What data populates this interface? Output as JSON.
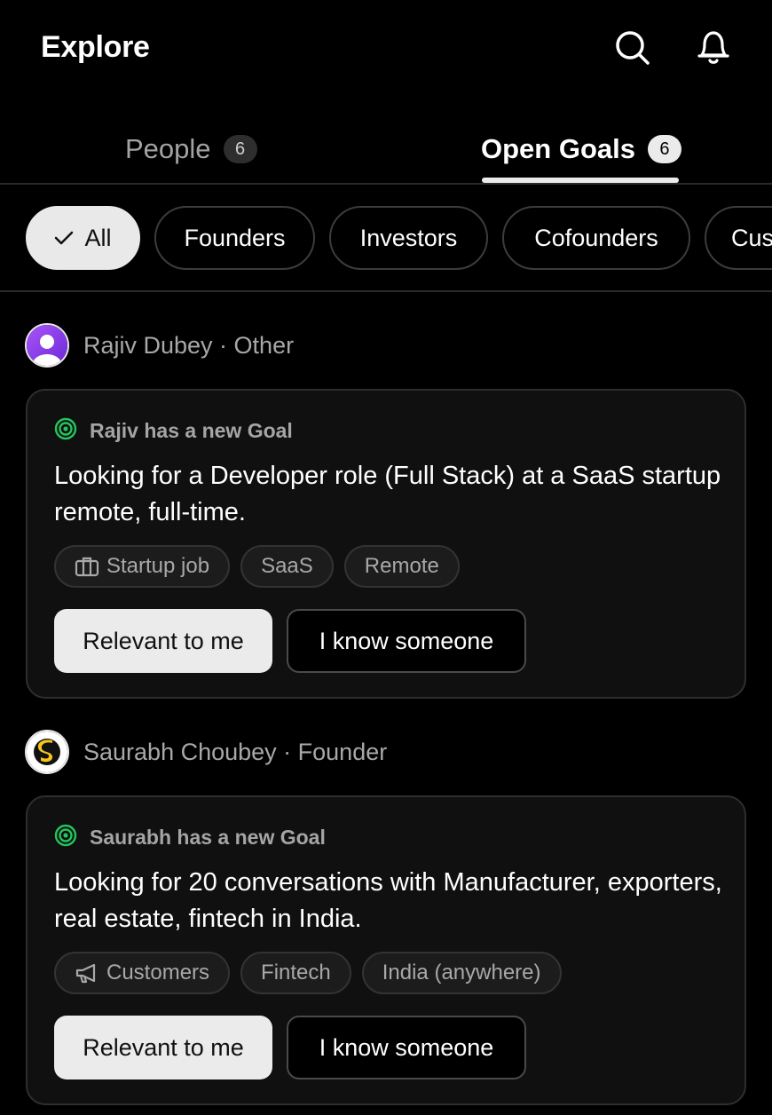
{
  "header": {
    "title": "Explore",
    "icons": [
      "search-icon",
      "bell-icon"
    ]
  },
  "tabs": [
    {
      "label": "People",
      "count": "6",
      "active": false
    },
    {
      "label": "Open Goals",
      "count": "6",
      "active": true
    }
  ],
  "filters": [
    {
      "label": "All",
      "active": true
    },
    {
      "label": "Founders",
      "active": false
    },
    {
      "label": "Investors",
      "active": false
    },
    {
      "label": "Cofounders",
      "active": false
    },
    {
      "label": "Cus",
      "active": false
    }
  ],
  "posts": [
    {
      "author": "Rajiv Dubey · Other",
      "goal_heading": "Rajiv has a new Goal",
      "goal_text": "Looking for a Developer role (Full Stack) at a SaaS startup remote, full-time.",
      "tags": [
        {
          "label": "Startup job",
          "icon": "briefcase-icon"
        },
        {
          "label": "SaaS"
        },
        {
          "label": "Remote"
        }
      ],
      "primary_action": "Relevant to me",
      "secondary_action": "I know someone"
    },
    {
      "author": "Saurabh Choubey · Founder",
      "goal_heading": "Saurabh has a new Goal",
      "goal_text": "Looking for 20 conversations with Manufacturer, exporters, real estate, fintech in India.",
      "tags": [
        {
          "label": "Customers",
          "icon": "megaphone-icon"
        },
        {
          "label": "Fintech"
        },
        {
          "label": "India (anywhere)"
        }
      ],
      "primary_action": "Relevant to me",
      "secondary_action": "I know someone"
    }
  ],
  "colors": {
    "background": "#000000",
    "goal_icon": "#22c55e",
    "avatar_gradient_start": "#a855f7",
    "avatar_gradient_end": "#6d28d9",
    "logo_yellow": "#f5c518"
  }
}
